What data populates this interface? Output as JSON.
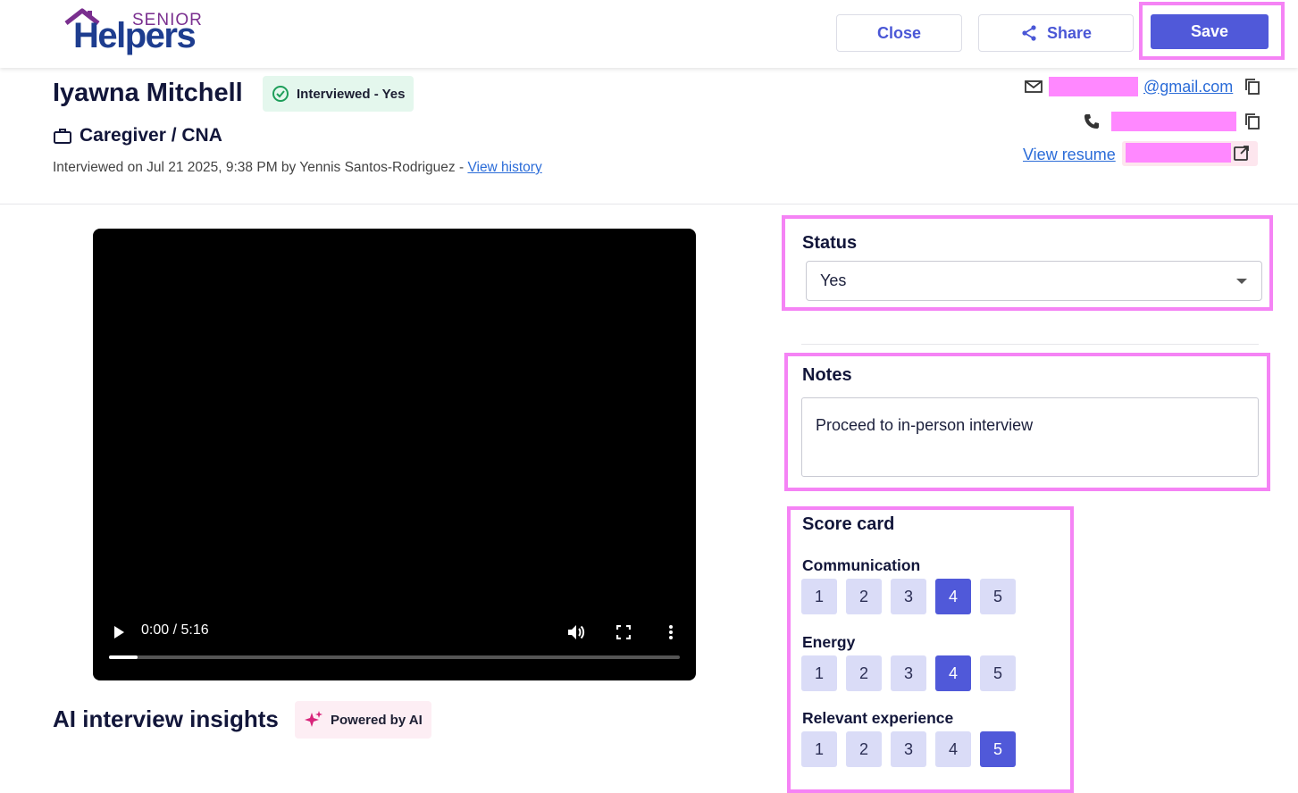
{
  "header": {
    "logo": {
      "senior": "SENIOR",
      "helpers": "Helpers"
    },
    "close_label": "Close",
    "share_label": "Share",
    "save_label": "Save"
  },
  "candidate": {
    "name": "Iyawna Mitchell",
    "status_badge": "Interviewed - Yes",
    "role": "Caregiver / CNA",
    "interview_meta": "Interviewed on Jul 21 2025, 9:38 PM by Yennis Santos-Rodriguez -",
    "view_history_label": "View history"
  },
  "contact": {
    "email_domain": "@gmail.com",
    "view_resume_label": "View resume"
  },
  "video": {
    "time": "0:00 / 5:16",
    "progress": 0.05
  },
  "insights": {
    "title": "AI interview insights",
    "badge": "Powered by AI"
  },
  "status_section": {
    "title": "Status",
    "selected": "Yes"
  },
  "notes_section": {
    "title": "Notes",
    "value": "Proceed to in-person interview"
  },
  "scorecard": {
    "title": "Score card",
    "options": [
      "1",
      "2",
      "3",
      "4",
      "5"
    ],
    "rows": [
      {
        "label": "Communication",
        "selected": "4"
      },
      {
        "label": "Energy",
        "selected": "4"
      },
      {
        "label": "Relevant experience",
        "selected": "5"
      }
    ]
  },
  "colors": {
    "accent": "#5059d9",
    "highlight": "#f583f5",
    "redaction": "#ff88ff"
  }
}
